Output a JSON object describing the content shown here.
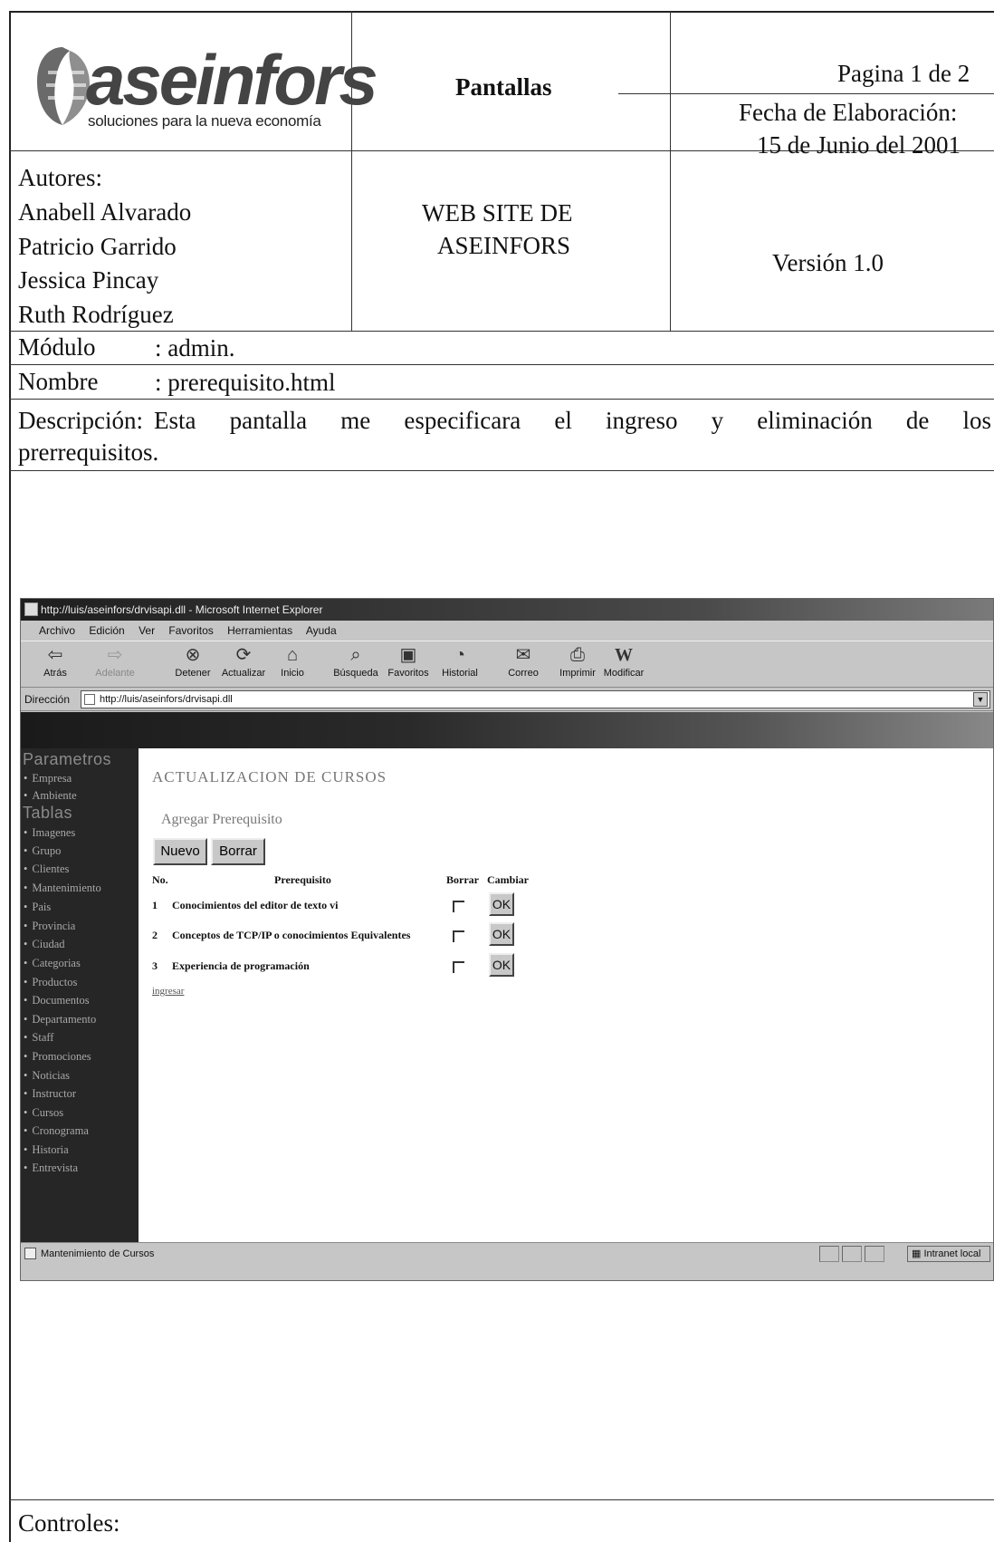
{
  "header": {
    "logo_word": "aseinfors",
    "logo_tagline": "soluciones para la nueva economía",
    "section_title": "Pantallas",
    "page": "Pagina 1 de 2",
    "date_label": "Fecha de Elaboración:",
    "date_value": "15 de Junio del 2001",
    "authors_label": "Autores:",
    "authors": [
      "Anabell Alvarado",
      "Patricio Garrido",
      "Jessica Pincay",
      "Ruth Rodríguez"
    ],
    "project_line1": "WEB SITE DE",
    "project_line2": "ASEINFORS",
    "version": "Versión 1.0"
  },
  "fields": {
    "module_label": "Módulo",
    "module_value": ": admin.",
    "name_label": "Nombre",
    "name_value": ": prerequisito.html",
    "desc_label": "Descripción:",
    "desc_words": [
      "Esta",
      "pantalla",
      "me",
      "especificara",
      "el",
      "ingreso",
      "y",
      "eliminación",
      "de",
      "los"
    ],
    "desc_line2": "prerrequisitos.",
    "controls_label": "Controles:"
  },
  "browser": {
    "title": "http://luis/aseinfors/drvisapi.dll - Microsoft Internet Explorer",
    "menu": [
      "Archivo",
      "Edición",
      "Ver",
      "Favoritos",
      "Herramientas",
      "Ayuda"
    ],
    "toolbar": [
      {
        "label": "Atrás",
        "icon": "back-arrow-icon",
        "glyph": "⇦"
      },
      {
        "label": "Adelante",
        "icon": "forward-arrow-icon",
        "glyph": "⇨"
      },
      {
        "label": "Detener",
        "icon": "stop-icon",
        "glyph": "⊗"
      },
      {
        "label": "Actualizar",
        "icon": "refresh-icon",
        "glyph": "⟳"
      },
      {
        "label": "Inicio",
        "icon": "home-icon",
        "glyph": "⌂"
      },
      {
        "label": "Búsqueda",
        "icon": "search-icon",
        "glyph": "⌕"
      },
      {
        "label": "Favoritos",
        "icon": "favorites-icon",
        "glyph": "▣"
      },
      {
        "label": "Historial",
        "icon": "history-icon",
        "glyph": "◔"
      },
      {
        "label": "Correo",
        "icon": "mail-icon",
        "glyph": "✉"
      },
      {
        "label": "Imprimir",
        "icon": "print-icon",
        "glyph": "⎙"
      },
      {
        "label": "Modificar",
        "icon": "edit-icon",
        "glyph": "W"
      }
    ],
    "address_label": "Dirección",
    "address_value": "http://luis/aseinfors/drvisapi.dll",
    "status_text": "Mantenimiento de Cursos",
    "status_zone": "Intranet local"
  },
  "app": {
    "sidebar_param_head": "Parametros",
    "sidebar_param_items": [
      "Empresa",
      "Ambiente"
    ],
    "sidebar_tables_head": "Tablas",
    "sidebar_table_items": [
      "Imagenes",
      "Grupo",
      "Clientes",
      "Mantenimiento",
      "Pais",
      "Provincia",
      "Ciudad",
      "Categorias",
      "Productos",
      "Documentos",
      "Departamento",
      "Staff",
      "Promociones",
      "Noticias",
      "Instructor",
      "Cursos",
      "Cronograma",
      "Historia",
      "Entrevista"
    ],
    "title": "ACTUALIZACION DE CURSOS",
    "subtitle": "Agregar Prerequisito",
    "new_button": "Nuevo",
    "delete_button": "Borrar",
    "col_no": "No.",
    "col_prereq": "Prerequisito",
    "col_delete": "Borrar",
    "col_change": "Cambiar",
    "rows": [
      {
        "num": "1",
        "text": "Conocimientos del editor de texto vi",
        "ok": "OK"
      },
      {
        "num": "2",
        "text": "Conceptos de TCP/IP o conocimientos Equivalentes",
        "ok": "OK"
      },
      {
        "num": "3",
        "text": "Experiencia de programación",
        "ok": "OK"
      }
    ],
    "link": "ingresar"
  }
}
